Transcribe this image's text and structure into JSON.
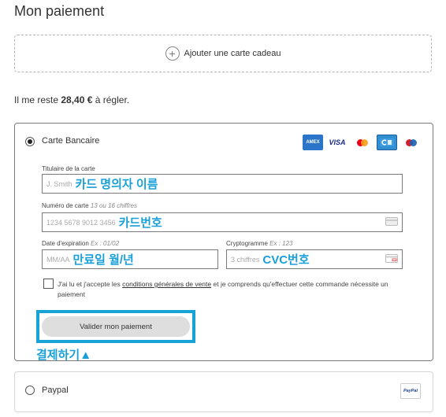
{
  "page": {
    "title": "Mon paiement"
  },
  "gift_card": {
    "label": "Ajouter une carte cadeau"
  },
  "remaining": {
    "prefix": "Il me reste",
    "amount": "28,40 €",
    "suffix": "à régler."
  },
  "card": {
    "label": "Carte Bancaire",
    "selected": true,
    "logos": [
      {
        "name": "amex",
        "text": "AMEX"
      },
      {
        "name": "visa",
        "text": "VISA"
      },
      {
        "name": "mastercard",
        "text": ""
      },
      {
        "name": "cb",
        "text": ""
      },
      {
        "name": "maestro",
        "text": ""
      }
    ],
    "holder": {
      "label": "Titulaire de la carte",
      "placeholder": "J. Smith",
      "annotation": "카드 명의자 이름"
    },
    "number": {
      "label": "Numéro de carte",
      "hint": "13 ou 16 chiffres",
      "placeholder": "1234 5678 9012 3456",
      "annotation": "카드번호"
    },
    "expiry": {
      "label": "Date d'expiration",
      "hint": "Ex : 01/02",
      "placeholder": "MM/AA",
      "annotation": "만료일 월/년"
    },
    "cvc": {
      "label": "Cryptogramme",
      "hint": "Ex : 123",
      "placeholder": "3 chiffres",
      "annotation": "CVC번호"
    },
    "terms": {
      "before": "J'ai lu et j'accepte les",
      "link": "conditions générales de vente",
      "after": "et je comprends qu'effectuer cette commande nécessite un paiement",
      "checked": false
    },
    "submit_label": "Valider mon paiement",
    "submit_annotation": "결제하기▲"
  },
  "paypal": {
    "label": "Paypal",
    "selected": false,
    "logo_text": "PayPal"
  },
  "colors": {
    "annotation": "#1aa0d8",
    "highlight": "#17a3d6",
    "button_bg": "#dedede"
  }
}
